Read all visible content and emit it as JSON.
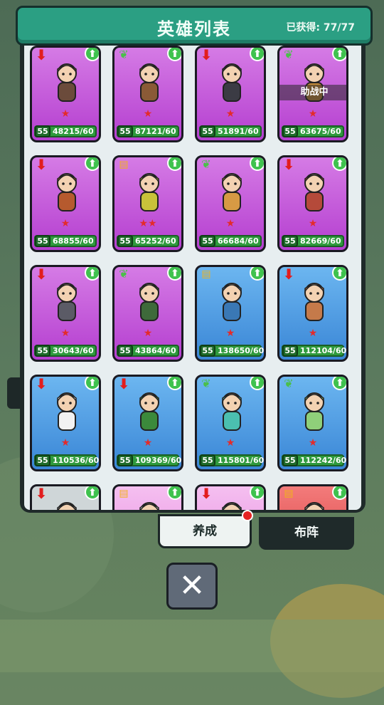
{
  "header": {
    "title": "英雄列表",
    "owned": "已获得: 77/77"
  },
  "cards": [
    {
      "color": "purple",
      "top": "down",
      "progress": "48215/60",
      "level": "55",
      "stars": "★",
      "helping": ""
    },
    {
      "color": "purple",
      "top": "leaf",
      "progress": "87121/60",
      "level": "55",
      "stars": "★",
      "helping": ""
    },
    {
      "color": "purple",
      "top": "down",
      "progress": "51891/60",
      "level": "55",
      "stars": "★",
      "helping": ""
    },
    {
      "color": "purple",
      "top": "leaf",
      "progress": "63675/60",
      "level": "55",
      "stars": "★",
      "helping": "助战中"
    },
    {
      "color": "purple",
      "top": "down",
      "progress": "68855/60",
      "level": "55",
      "stars": "★",
      "helping": ""
    },
    {
      "color": "purple",
      "top": "book",
      "progress": "65252/60",
      "level": "55",
      "stars": "★★",
      "helping": ""
    },
    {
      "color": "purple",
      "top": "leaf",
      "progress": "66684/60",
      "level": "55",
      "stars": "★",
      "helping": ""
    },
    {
      "color": "purple",
      "top": "down",
      "progress": "82669/60",
      "level": "55",
      "stars": "★",
      "helping": ""
    },
    {
      "color": "purple",
      "top": "down",
      "progress": "30643/60",
      "level": "55",
      "stars": "★",
      "helping": ""
    },
    {
      "color": "purple",
      "top": "leaf",
      "progress": "43864/60",
      "level": "55",
      "stars": "★",
      "helping": ""
    },
    {
      "color": "blue",
      "top": "book",
      "progress": "138650/60",
      "level": "55",
      "stars": "★",
      "helping": ""
    },
    {
      "color": "blue",
      "top": "down",
      "progress": "112104/60",
      "level": "55",
      "stars": "★",
      "helping": ""
    },
    {
      "color": "blue",
      "top": "down",
      "progress": "110536/60",
      "level": "55",
      "stars": "★",
      "helping": ""
    },
    {
      "color": "blue",
      "top": "down",
      "progress": "109369/60",
      "level": "55",
      "stars": "★",
      "helping": ""
    },
    {
      "color": "blue",
      "top": "leaf",
      "progress": "115801/60",
      "level": "55",
      "stars": "★",
      "helping": ""
    },
    {
      "color": "blue",
      "top": "leaf",
      "progress": "112242/60",
      "level": "55",
      "stars": "★",
      "helping": ""
    },
    {
      "color": "gray",
      "top": "down",
      "progress": "",
      "level": "",
      "stars": "",
      "helping": ""
    },
    {
      "color": "pink",
      "top": "book",
      "progress": "",
      "level": "",
      "stars": "",
      "helping": ""
    },
    {
      "color": "pink",
      "top": "down",
      "progress": "",
      "level": "",
      "stars": "",
      "helping": ""
    },
    {
      "color": "red",
      "top": "book",
      "progress": "",
      "level": "",
      "stars": "",
      "helping": ""
    }
  ],
  "tabs": {
    "train": "养成",
    "formation": "布阵"
  },
  "icons": {
    "up": "arrow-up-icon",
    "down": "arrow-down-icon",
    "leaf": "leaf-icon",
    "book": "book-icon",
    "close": "close-icon"
  },
  "colors": {
    "header": "#2b9f83",
    "purple": "#c25ad9",
    "blue": "#4f9be3",
    "bar": "#2f9a3d"
  }
}
